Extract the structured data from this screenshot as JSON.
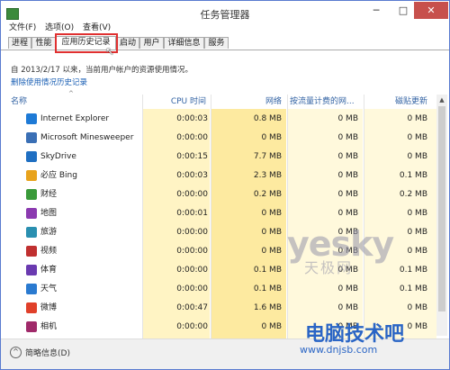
{
  "window": {
    "title": "任务管理器",
    "minimize_glyph": "─",
    "maximize_glyph": "□",
    "close_glyph": "✕"
  },
  "menu": [
    {
      "label": "文件(F)"
    },
    {
      "label": "选项(O)"
    },
    {
      "label": "查看(V)"
    }
  ],
  "tabs": [
    {
      "label": "进程"
    },
    {
      "label": "性能"
    },
    {
      "label": "应用历史记录",
      "active": true
    },
    {
      "label": "启动"
    },
    {
      "label": "用户"
    },
    {
      "label": "详细信息"
    },
    {
      "label": "服务"
    }
  ],
  "info_text": "自 2013/2/17 以来，当前用户帐户的资源使用情况。",
  "delete_link": "删除使用情况历史记录",
  "columns": {
    "name": "名称",
    "cpu": "CPU 时间",
    "network": "网络",
    "metered": "按流量计费的网...",
    "tile": "磁贴更新"
  },
  "rows": [
    {
      "name": "Internet Explorer",
      "cpu": "0:00:03",
      "network": "0.8 MB",
      "metered": "0 MB",
      "tile": "0 MB",
      "icon": "internet-explorer-icon",
      "color": "#1e7ad6"
    },
    {
      "name": "Microsoft Minesweeper",
      "cpu": "0:00:00",
      "network": "0 MB",
      "metered": "0 MB",
      "tile": "0 MB",
      "icon": "minesweeper-icon",
      "color": "#3a6fb5"
    },
    {
      "name": "SkyDrive",
      "cpu": "0:00:15",
      "network": "7.7 MB",
      "metered": "0 MB",
      "tile": "0 MB",
      "icon": "skydrive-icon",
      "color": "#1f6fc2"
    },
    {
      "name": "必应 Bing",
      "cpu": "0:00:03",
      "network": "2.3 MB",
      "metered": "0 MB",
      "tile": "0.1 MB",
      "icon": "bing-icon",
      "color": "#e8a31d"
    },
    {
      "name": "财经",
      "cpu": "0:00:00",
      "network": "0.2 MB",
      "metered": "0 MB",
      "tile": "0.2 MB",
      "icon": "finance-icon",
      "color": "#3a9a3a"
    },
    {
      "name": "地图",
      "cpu": "0:00:01",
      "network": "0 MB",
      "metered": "0 MB",
      "tile": "0 MB",
      "icon": "maps-icon",
      "color": "#8b3ab0"
    },
    {
      "name": "旅游",
      "cpu": "0:00:00",
      "network": "0 MB",
      "metered": "0 MB",
      "tile": "0 MB",
      "icon": "travel-icon",
      "color": "#2a8fb0"
    },
    {
      "name": "视频",
      "cpu": "0:00:00",
      "network": "0 MB",
      "metered": "0 MB",
      "tile": "0 MB",
      "icon": "video-icon",
      "color": "#c03030"
    },
    {
      "name": "体育",
      "cpu": "0:00:00",
      "network": "0.1 MB",
      "metered": "0 MB",
      "tile": "0.1 MB",
      "icon": "sports-icon",
      "color": "#6a3ab0"
    },
    {
      "name": "天气",
      "cpu": "0:00:00",
      "network": "0.1 MB",
      "metered": "0 MB",
      "tile": "0.1 MB",
      "icon": "weather-icon",
      "color": "#2a7ad0"
    },
    {
      "name": "微博",
      "cpu": "0:00:47",
      "network": "1.6 MB",
      "metered": "0 MB",
      "tile": "0 MB",
      "icon": "weibo-icon",
      "color": "#e0402a"
    },
    {
      "name": "相机",
      "cpu": "0:00:00",
      "network": "0 MB",
      "metered": "0 MB",
      "tile": "0 MB",
      "icon": "camera-icon",
      "color": "#a02a6a"
    }
  ],
  "footer": {
    "label": "简略信息(D)"
  },
  "watermark": {
    "yesky": "yesky",
    "yesky_sub": "天极网",
    "site": "电脑技术吧",
    "url": "www.dnjsb.com"
  },
  "colors": {
    "cpu_bg": "#fff4c4",
    "network_bg": "#fdeaa0",
    "metered_bg": "#fff9dc",
    "tile_bg": "#fff9dc",
    "highlight": "#e03030"
  }
}
